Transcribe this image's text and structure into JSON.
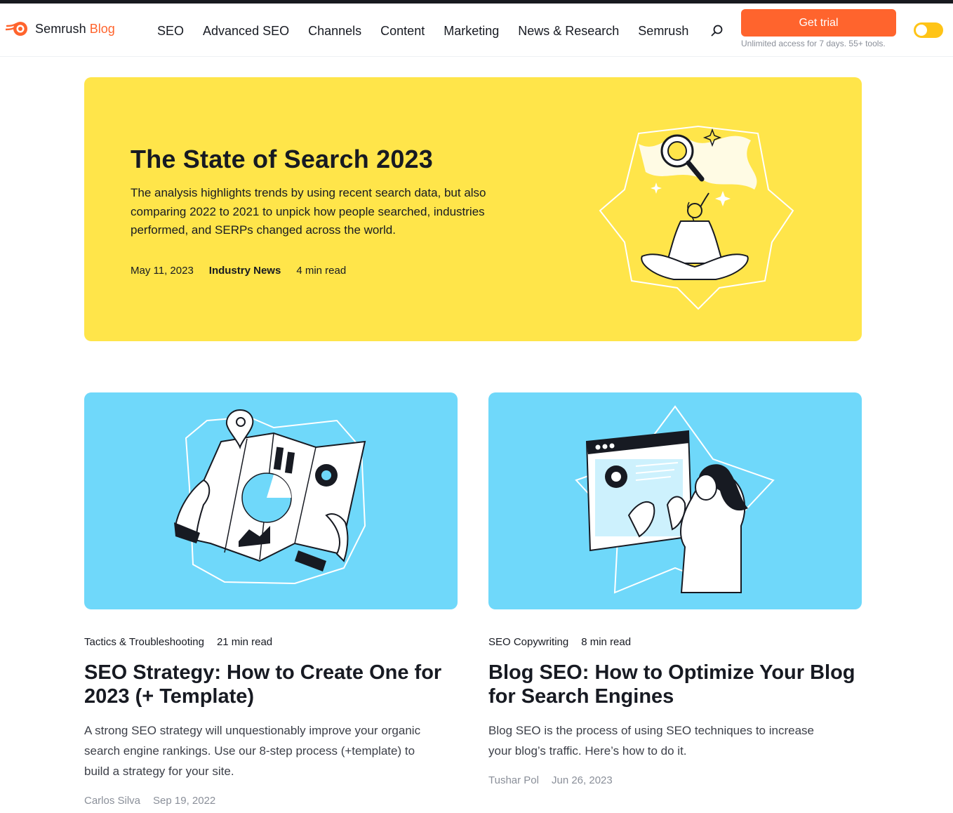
{
  "header": {
    "brand": "Semrush",
    "brand_suffix": "Blog",
    "nav": [
      "SEO",
      "Advanced SEO",
      "Channels",
      "Content",
      "Marketing",
      "News & Research",
      "Semrush"
    ],
    "cta_label": "Get trial",
    "cta_note": "Unlimited access for 7 days. 55+ tools.",
    "search_icon": "search-icon",
    "theme_toggle": {
      "state": "light"
    }
  },
  "colors": {
    "accent": "#ff642d",
    "hero_bg": "#ffe54a",
    "card_bg": "#6fd8fa",
    "toggle": "#ffc417"
  },
  "hero": {
    "title": "The State of Search 2023",
    "description": "The analysis highlights trends by using recent search data, but also comparing 2022 to 2021 to unpick how people searched, industries performed, and SERPs changed across the world.",
    "date": "May 11, 2023",
    "category": "Industry News",
    "read_time": "4 min read",
    "illustration": "meditation-search-illustration"
  },
  "cards": [
    {
      "category": "Tactics & Troubleshooting",
      "read_time": "21 min read",
      "title": "SEO Strategy: How to Create One for 2023 (+ Template)",
      "description": "A strong SEO strategy will unquestionably improve your organic search engine rankings. Use our 8-step process (+template) to build a strategy for your site.",
      "author": "Carlos Silva",
      "date": "Sep 19, 2022",
      "illustration": "map-illustration"
    },
    {
      "category": "SEO Copywriting",
      "read_time": "8 min read",
      "title": "Blog SEO: How to Optimize Your Blog for Search Engines",
      "description": "Blog SEO is the process of using SEO techniques to increase your blog’s traffic. Here’s how to do it.",
      "author": "Tushar Pol",
      "date": "Jun 26, 2023",
      "illustration": "browser-woman-illustration"
    }
  ]
}
